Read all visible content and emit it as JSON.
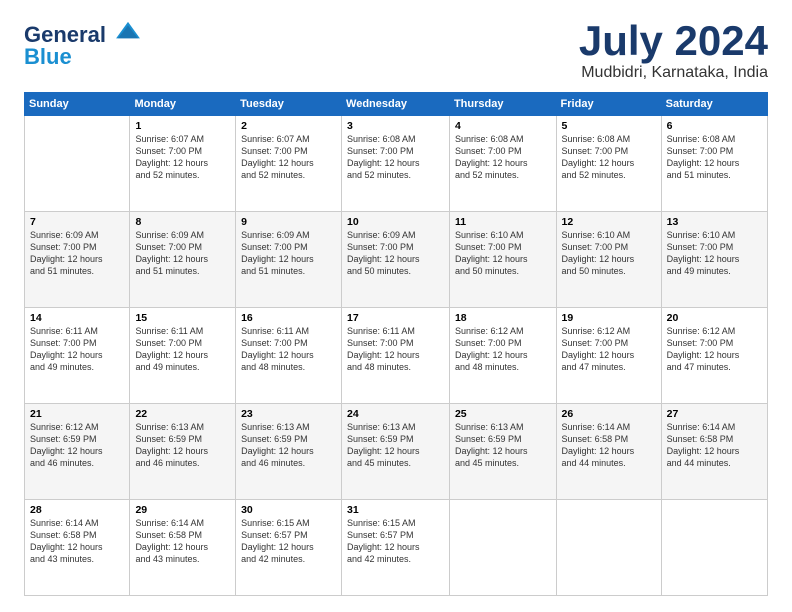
{
  "logo": {
    "general": "General",
    "blue": "Blue"
  },
  "title": "July 2024",
  "location": "Mudbidri, Karnataka, India",
  "days_of_week": [
    "Sunday",
    "Monday",
    "Tuesday",
    "Wednesday",
    "Thursday",
    "Friday",
    "Saturday"
  ],
  "weeks": [
    [
      {
        "day": "",
        "info": ""
      },
      {
        "day": "1",
        "info": "Sunrise: 6:07 AM\nSunset: 7:00 PM\nDaylight: 12 hours\nand 52 minutes."
      },
      {
        "day": "2",
        "info": "Sunrise: 6:07 AM\nSunset: 7:00 PM\nDaylight: 12 hours\nand 52 minutes."
      },
      {
        "day": "3",
        "info": "Sunrise: 6:08 AM\nSunset: 7:00 PM\nDaylight: 12 hours\nand 52 minutes."
      },
      {
        "day": "4",
        "info": "Sunrise: 6:08 AM\nSunset: 7:00 PM\nDaylight: 12 hours\nand 52 minutes."
      },
      {
        "day": "5",
        "info": "Sunrise: 6:08 AM\nSunset: 7:00 PM\nDaylight: 12 hours\nand 52 minutes."
      },
      {
        "day": "6",
        "info": "Sunrise: 6:08 AM\nSunset: 7:00 PM\nDaylight: 12 hours\nand 51 minutes."
      }
    ],
    [
      {
        "day": "7",
        "info": "Sunrise: 6:09 AM\nSunset: 7:00 PM\nDaylight: 12 hours\nand 51 minutes."
      },
      {
        "day": "8",
        "info": "Sunrise: 6:09 AM\nSunset: 7:00 PM\nDaylight: 12 hours\nand 51 minutes."
      },
      {
        "day": "9",
        "info": "Sunrise: 6:09 AM\nSunset: 7:00 PM\nDaylight: 12 hours\nand 51 minutes."
      },
      {
        "day": "10",
        "info": "Sunrise: 6:09 AM\nSunset: 7:00 PM\nDaylight: 12 hours\nand 50 minutes."
      },
      {
        "day": "11",
        "info": "Sunrise: 6:10 AM\nSunset: 7:00 PM\nDaylight: 12 hours\nand 50 minutes."
      },
      {
        "day": "12",
        "info": "Sunrise: 6:10 AM\nSunset: 7:00 PM\nDaylight: 12 hours\nand 50 minutes."
      },
      {
        "day": "13",
        "info": "Sunrise: 6:10 AM\nSunset: 7:00 PM\nDaylight: 12 hours\nand 49 minutes."
      }
    ],
    [
      {
        "day": "14",
        "info": "Sunrise: 6:11 AM\nSunset: 7:00 PM\nDaylight: 12 hours\nand 49 minutes."
      },
      {
        "day": "15",
        "info": "Sunrise: 6:11 AM\nSunset: 7:00 PM\nDaylight: 12 hours\nand 49 minutes."
      },
      {
        "day": "16",
        "info": "Sunrise: 6:11 AM\nSunset: 7:00 PM\nDaylight: 12 hours\nand 48 minutes."
      },
      {
        "day": "17",
        "info": "Sunrise: 6:11 AM\nSunset: 7:00 PM\nDaylight: 12 hours\nand 48 minutes."
      },
      {
        "day": "18",
        "info": "Sunrise: 6:12 AM\nSunset: 7:00 PM\nDaylight: 12 hours\nand 48 minutes."
      },
      {
        "day": "19",
        "info": "Sunrise: 6:12 AM\nSunset: 7:00 PM\nDaylight: 12 hours\nand 47 minutes."
      },
      {
        "day": "20",
        "info": "Sunrise: 6:12 AM\nSunset: 7:00 PM\nDaylight: 12 hours\nand 47 minutes."
      }
    ],
    [
      {
        "day": "21",
        "info": "Sunrise: 6:12 AM\nSunset: 6:59 PM\nDaylight: 12 hours\nand 46 minutes."
      },
      {
        "day": "22",
        "info": "Sunrise: 6:13 AM\nSunset: 6:59 PM\nDaylight: 12 hours\nand 46 minutes."
      },
      {
        "day": "23",
        "info": "Sunrise: 6:13 AM\nSunset: 6:59 PM\nDaylight: 12 hours\nand 46 minutes."
      },
      {
        "day": "24",
        "info": "Sunrise: 6:13 AM\nSunset: 6:59 PM\nDaylight: 12 hours\nand 45 minutes."
      },
      {
        "day": "25",
        "info": "Sunrise: 6:13 AM\nSunset: 6:59 PM\nDaylight: 12 hours\nand 45 minutes."
      },
      {
        "day": "26",
        "info": "Sunrise: 6:14 AM\nSunset: 6:58 PM\nDaylight: 12 hours\nand 44 minutes."
      },
      {
        "day": "27",
        "info": "Sunrise: 6:14 AM\nSunset: 6:58 PM\nDaylight: 12 hours\nand 44 minutes."
      }
    ],
    [
      {
        "day": "28",
        "info": "Sunrise: 6:14 AM\nSunset: 6:58 PM\nDaylight: 12 hours\nand 43 minutes."
      },
      {
        "day": "29",
        "info": "Sunrise: 6:14 AM\nSunset: 6:58 PM\nDaylight: 12 hours\nand 43 minutes."
      },
      {
        "day": "30",
        "info": "Sunrise: 6:15 AM\nSunset: 6:57 PM\nDaylight: 12 hours\nand 42 minutes."
      },
      {
        "day": "31",
        "info": "Sunrise: 6:15 AM\nSunset: 6:57 PM\nDaylight: 12 hours\nand 42 minutes."
      },
      {
        "day": "",
        "info": ""
      },
      {
        "day": "",
        "info": ""
      },
      {
        "day": "",
        "info": ""
      }
    ]
  ]
}
